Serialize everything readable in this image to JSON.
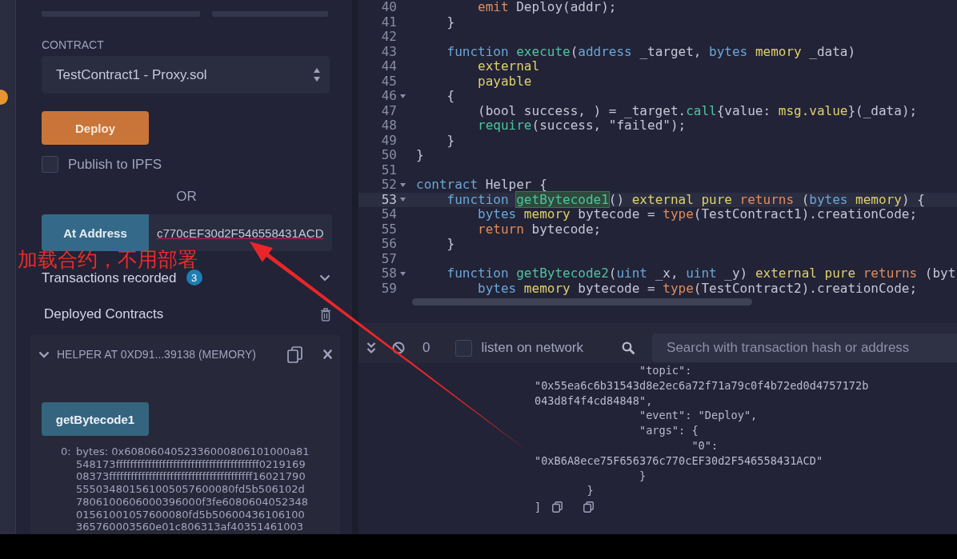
{
  "run_panel": {
    "contract_label": "CONTRACT",
    "contract_select": "TestContract1 - Proxy.sol",
    "deploy_button": "Deploy",
    "publish_ipfs": {
      "label": "Publish to IPFS",
      "checked": false
    },
    "or_label": "OR",
    "at_address": {
      "button": "At Address",
      "value": "c770cEF30d2F546558431ACD"
    },
    "transactions": {
      "label": "Transactions recorded",
      "count": "3"
    },
    "deployed_title": "Deployed Contracts",
    "instance": {
      "title": "HELPER AT 0XD91...39138 (MEMORY)",
      "expanded": true,
      "function_button": "getBytecode1",
      "output_index": "0:",
      "output_value": "bytes: 0x6080604052336000806101000a81548173ffffffffffffffffffffffffffffffffffffffff021916908373ffffffffffffffffffffffffffffffffffffffff16021790555034801561005057600080fd5b506102d7806100606000396000f3fe608060405234801561001057600080fd5b50600436106100365760003560e01c806313af40351461003"
    }
  },
  "annotation": {
    "text": "加载合约，不用部署"
  },
  "editor": {
    "lines": [
      {
        "number": "40",
        "foldable": false,
        "current": false,
        "tokens": [
          {
            "text": "        emit",
            "kind": "control"
          },
          {
            "text": " Deploy(addr);",
            "kind": "plain"
          }
        ]
      },
      {
        "number": "41",
        "foldable": false,
        "current": false,
        "tokens": [
          {
            "text": "    }",
            "kind": "plain"
          }
        ]
      },
      {
        "number": "42",
        "foldable": false,
        "current": false
      },
      {
        "number": "43",
        "foldable": false,
        "current": false,
        "tokens": [
          {
            "text": "    function ",
            "kind": "keyword"
          },
          {
            "text": "execute",
            "kind": "function"
          },
          {
            "text": "(",
            "kind": "plain"
          },
          {
            "text": "address",
            "kind": "keyword"
          },
          {
            "text": " _target, ",
            "kind": "plain"
          },
          {
            "text": "bytes ",
            "kind": "keyword"
          },
          {
            "text": "memory",
            "kind": "modifier"
          },
          {
            "text": " _data)",
            "kind": "plain"
          }
        ]
      },
      {
        "number": "44",
        "foldable": false,
        "current": false,
        "tokens": [
          {
            "text": "        external",
            "kind": "modifier"
          }
        ]
      },
      {
        "number": "45",
        "foldable": false,
        "current": false,
        "tokens": [
          {
            "text": "        payable",
            "kind": "modifier"
          }
        ]
      },
      {
        "number": "46",
        "foldable": true,
        "current": false,
        "tokens": [
          {
            "text": "    {",
            "kind": "plain"
          }
        ]
      },
      {
        "number": "47",
        "foldable": false,
        "current": false,
        "tokens": [
          {
            "text": "        (bool success, ) = _target.",
            "kind": "plain"
          },
          {
            "text": "call",
            "kind": "function"
          },
          {
            "text": "{value: ",
            "kind": "plain"
          },
          {
            "text": "msg.value",
            "kind": "modifier"
          },
          {
            "text": "}(_data);",
            "kind": "plain"
          }
        ]
      },
      {
        "number": "48",
        "foldable": false,
        "current": false,
        "tokens": [
          {
            "text": "        require",
            "kind": "function"
          },
          {
            "text": "(success, \"failed\");",
            "kind": "plain"
          }
        ]
      },
      {
        "number": "49",
        "foldable": false,
        "current": false,
        "tokens": [
          {
            "text": "    }",
            "kind": "plain"
          }
        ]
      },
      {
        "number": "50",
        "foldable": false,
        "current": false,
        "tokens": [
          {
            "text": "}",
            "kind": "plain"
          }
        ]
      },
      {
        "number": "51",
        "foldable": false,
        "current": false
      },
      {
        "number": "52",
        "foldable": true,
        "current": false,
        "tokens": [
          {
            "text": "contract ",
            "kind": "keyword"
          },
          {
            "text": "Helper {",
            "kind": "plain"
          }
        ]
      },
      {
        "number": "53",
        "foldable": true,
        "current": true,
        "tokens": [
          {
            "text": "    function ",
            "kind": "keyword"
          },
          {
            "text": "getBytecode1",
            "kind": "match"
          },
          {
            "text": "() ",
            "kind": "plain"
          },
          {
            "text": "external pure ",
            "kind": "modifier"
          },
          {
            "text": "returns",
            "kind": "control"
          },
          {
            "text": " (",
            "kind": "plain"
          },
          {
            "text": "bytes ",
            "kind": "keyword"
          },
          {
            "text": "memory",
            "kind": "modifier"
          },
          {
            "text": ") {",
            "kind": "plain"
          }
        ]
      },
      {
        "number": "54",
        "foldable": false,
        "current": false,
        "tokens": [
          {
            "text": "        bytes ",
            "kind": "keyword"
          },
          {
            "text": "memory",
            "kind": "modifier"
          },
          {
            "text": " bytecode = ",
            "kind": "plain"
          },
          {
            "text": "type",
            "kind": "control"
          },
          {
            "text": "(TestContract1).creationCode;",
            "kind": "plain"
          }
        ]
      },
      {
        "number": "55",
        "foldable": false,
        "current": false,
        "tokens": [
          {
            "text": "        return",
            "kind": "control"
          },
          {
            "text": " bytecode;",
            "kind": "plain"
          }
        ]
      },
      {
        "number": "56",
        "foldable": false,
        "current": false,
        "tokens": [
          {
            "text": "    }",
            "kind": "plain"
          }
        ]
      },
      {
        "number": "57",
        "foldable": false,
        "current": false
      },
      {
        "number": "58",
        "foldable": true,
        "current": false,
        "tokens": [
          {
            "text": "    function ",
            "kind": "keyword"
          },
          {
            "text": "getBytecode2",
            "kind": "function"
          },
          {
            "text": "(",
            "kind": "plain"
          },
          {
            "text": "uint",
            "kind": "keyword"
          },
          {
            "text": " _x, ",
            "kind": "plain"
          },
          {
            "text": "uint",
            "kind": "keyword"
          },
          {
            "text": " _y) ",
            "kind": "plain"
          },
          {
            "text": "external pure ",
            "kind": "modifier"
          },
          {
            "text": "returns",
            "kind": "control"
          },
          {
            "text": " (byt",
            "kind": "plain"
          }
        ]
      },
      {
        "number": "59",
        "foldable": false,
        "current": false,
        "tokens": [
          {
            "text": "        bytes ",
            "kind": "keyword"
          },
          {
            "text": "memory",
            "kind": "modifier"
          },
          {
            "text": " bytecode = ",
            "kind": "plain"
          },
          {
            "text": "type",
            "kind": "control"
          },
          {
            "text": "(TestContract2).creationCode;",
            "kind": "plain"
          }
        ]
      }
    ]
  },
  "terminal": {
    "pending_count": "0",
    "listen_on_network": {
      "label": "listen on network",
      "checked": false
    },
    "search": {
      "placeholder": "Search with transaction hash or address"
    },
    "log_lines": [
      "                \"topic\":",
      "\"0x55ea6c6b31543d8e2ec6a72f71a79c0f4b72ed0d4757172b",
      "043d8f4f4cd84848\",",
      "                \"event\": \"Deploy\",",
      "                \"args\": {",
      "                        \"0\":",
      "\"0xB6A8ece75F656376c770cEF30d2F546558431ACD\"",
      "                }",
      "        }"
    ],
    "closing_bracket": "]"
  }
}
